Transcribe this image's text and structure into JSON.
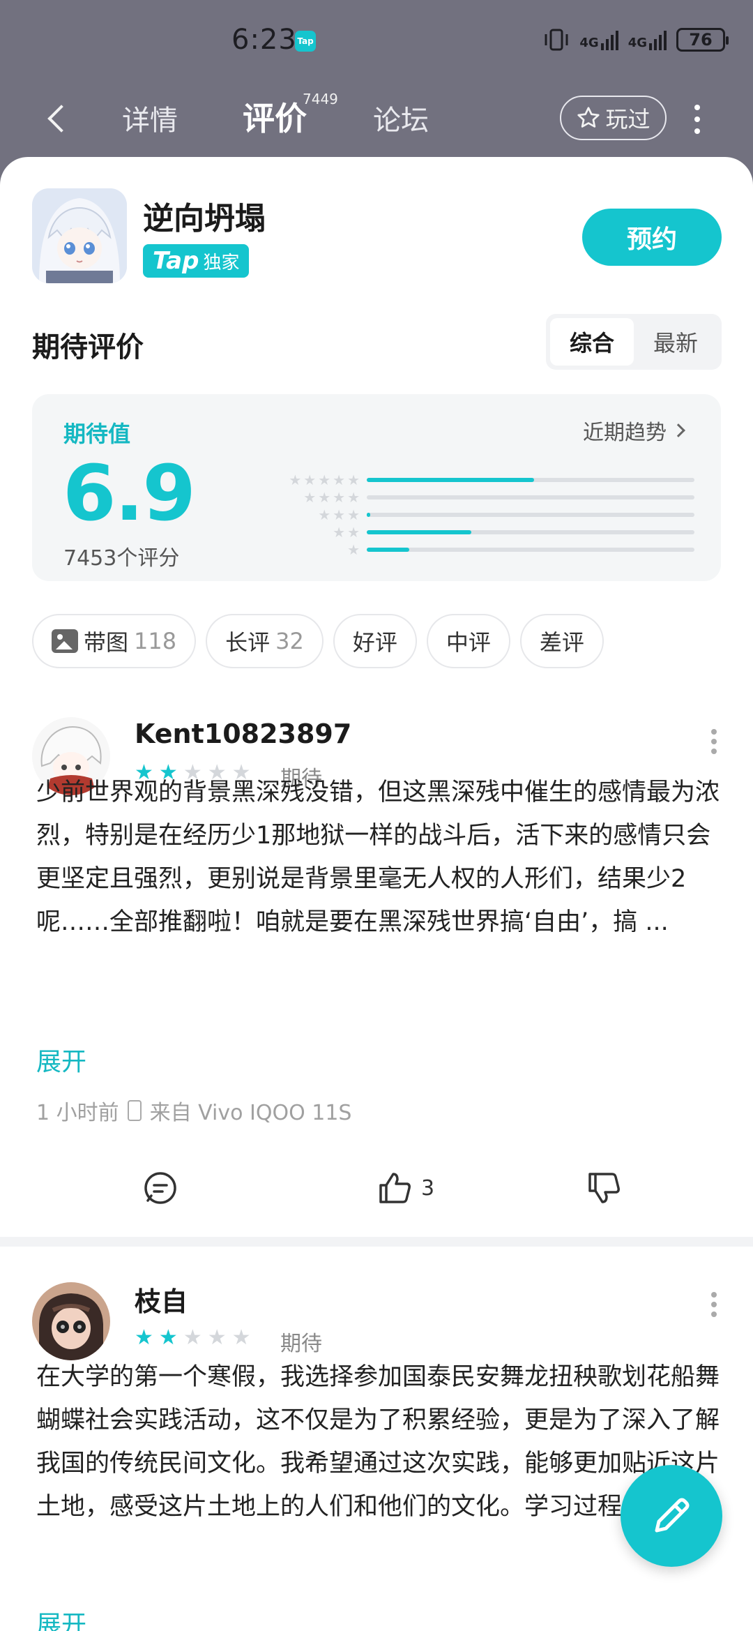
{
  "status_bar": {
    "time": "6:23",
    "app_badge": "Tap",
    "network1": "4G",
    "network2": "4G",
    "battery": "76"
  },
  "nav": {
    "tabs": [
      {
        "label": "详情"
      },
      {
        "label": "评价",
        "count": "7449"
      },
      {
        "label": "论坛"
      }
    ],
    "played_label": "玩过"
  },
  "game": {
    "title": "逆向坍塌",
    "badge_brand": "Tap",
    "badge_text": "独家",
    "reserve_label": "预约"
  },
  "section": {
    "title": "期待评价",
    "sort_options": [
      "综合",
      "最新"
    ],
    "sort_selected": "综合"
  },
  "score": {
    "label": "期待值",
    "value": "6.9",
    "count_text": "7453个评分",
    "trend_label": "近期趋势",
    "distribution": [
      {
        "stars": 5,
        "fraction": 0.51
      },
      {
        "stars": 4,
        "fraction": 0.0
      },
      {
        "stars": 3,
        "fraction": 0.01
      },
      {
        "stars": 2,
        "fraction": 0.32
      },
      {
        "stars": 1,
        "fraction": 0.13
      }
    ]
  },
  "filters": [
    {
      "label": "带图",
      "count": "118",
      "icon": "image-icon"
    },
    {
      "label": "长评",
      "count": "32"
    },
    {
      "label": "好评",
      "count": ""
    },
    {
      "label": "中评",
      "count": ""
    },
    {
      "label": "差评",
      "count": ""
    }
  ],
  "reviews": [
    {
      "user": "Kent10823897",
      "rating": 2,
      "rating_label": "期待",
      "text": "少前世界观的背景黑深残没错，但这黑深残中催生的感情最为浓烈，特别是在经历少1那地狱一样的战斗后，活下来的感情只会更坚定且强烈，更别说是背景里毫无人权的人形们，结果少2呢……全部推翻啦！咱就是要在黑深残世界搞‘自由’，搞 ...",
      "expand_label": "展开",
      "time": "1 小时前",
      "device": "来自 Vivo IQOO 11S",
      "likes": "3"
    },
    {
      "user": "枝自",
      "rating": 2,
      "rating_label": "期待",
      "text": "在大学的第一个寒假，我选择参加国泰民安舞龙扭秧歌划花船舞蝴蝶社会实践活动，这不仅是为了积累经验，更是为了深入了解我国的传统民间文化。我希望通过这次实践，能够更加贴近这片土地，感受这片土地上的人们和他们的文化。学习过程中 ...",
      "expand_label": "展开"
    }
  ],
  "colors": {
    "accent": "#15c5ce",
    "header_bg": "#72717f"
  }
}
